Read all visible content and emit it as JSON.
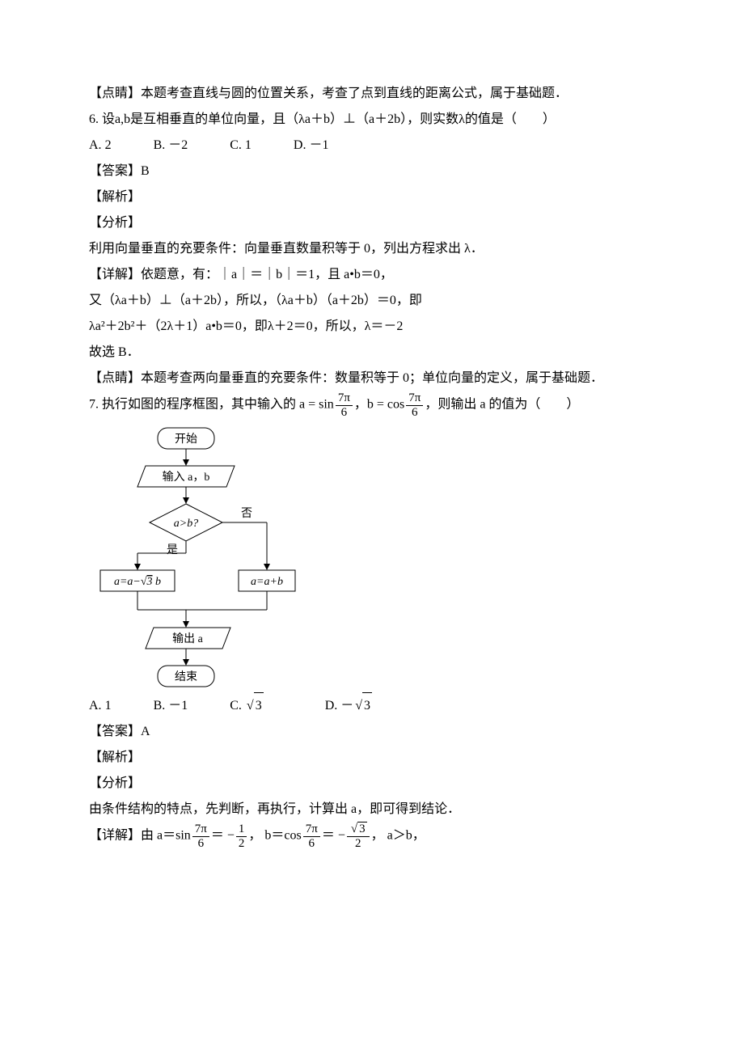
{
  "p5_comment": "【点睛】本题考查直线与圆的位置关系，考查了点到直线的距离公式，属于基础题．",
  "q6": {
    "stem_a": "6. 设a,b是互相垂直的单位向量，且（λa＋b）⊥（a＋2b），则实数λ的值是（　　）",
    "options": {
      "A": "2",
      "B": "－2",
      "C": "1",
      "D": "－1"
    },
    "answer_label": "【答案】",
    "answer": "B",
    "jiexi": "【解析】",
    "fenxi": "【分析】",
    "fenxi_body": "利用向量垂直的充要条件：向量垂直数量积等于 0，列出方程求出 λ．",
    "xiangjie_label": "【详解】",
    "xiangjie_a": "依题意，有：｜a｜＝｜b｜＝1，且 a•b＝0，",
    "xiangjie_b": "又（λa＋b）⊥（a＋2b），所以，（λa＋b）（a＋2b）＝0，即",
    "xiangjie_c": "λa²＋2b²＋（2λ＋1）a•b＝0，即λ＋2＝0，所以，λ＝－2",
    "xiangjie_d": "故选 B．",
    "comment": "【点睛】本题考查两向量垂直的充要条件：数量积等于 0；单位向量的定义，属于基础题．"
  },
  "q7": {
    "stem_prefix": "7. 执行如图的程序框图，其中输入的 a = sin",
    "stem_mid": "，b = cos",
    "stem_suffix": "，则输出 a 的值为（　　）",
    "frac_num": "7π",
    "frac_den": "6",
    "flow": {
      "start": "开始",
      "input": "输入 a，b",
      "cond": "a>b?",
      "no": "否",
      "yes": "是",
      "left": "a=a− √3 b",
      "right": "a=a+b",
      "output": "输出 a",
      "end": "结束"
    },
    "options": {
      "A": "1",
      "B": "－1",
      "C_sqrt": "3",
      "D_neg_sqrt": "3"
    },
    "answer_label": "【答案】",
    "answer": "A",
    "jiexi": "【解析】",
    "fenxi": "【分析】",
    "fenxi_body": "由条件结构的特点，先判断，再执行，计算出 a，即可得到结论．",
    "xiangjie_label": "【详解】",
    "detail_prefix": "由 a＝sin",
    "detail_eq1a": "＝ −",
    "detail_half_num": "1",
    "detail_half_den": "2",
    "detail_mid": "， b＝cos",
    "detail_eq2a": "＝ −",
    "detail_sqrt3": "3",
    "detail_den2": "2",
    "detail_suffix": "， a＞b，"
  }
}
